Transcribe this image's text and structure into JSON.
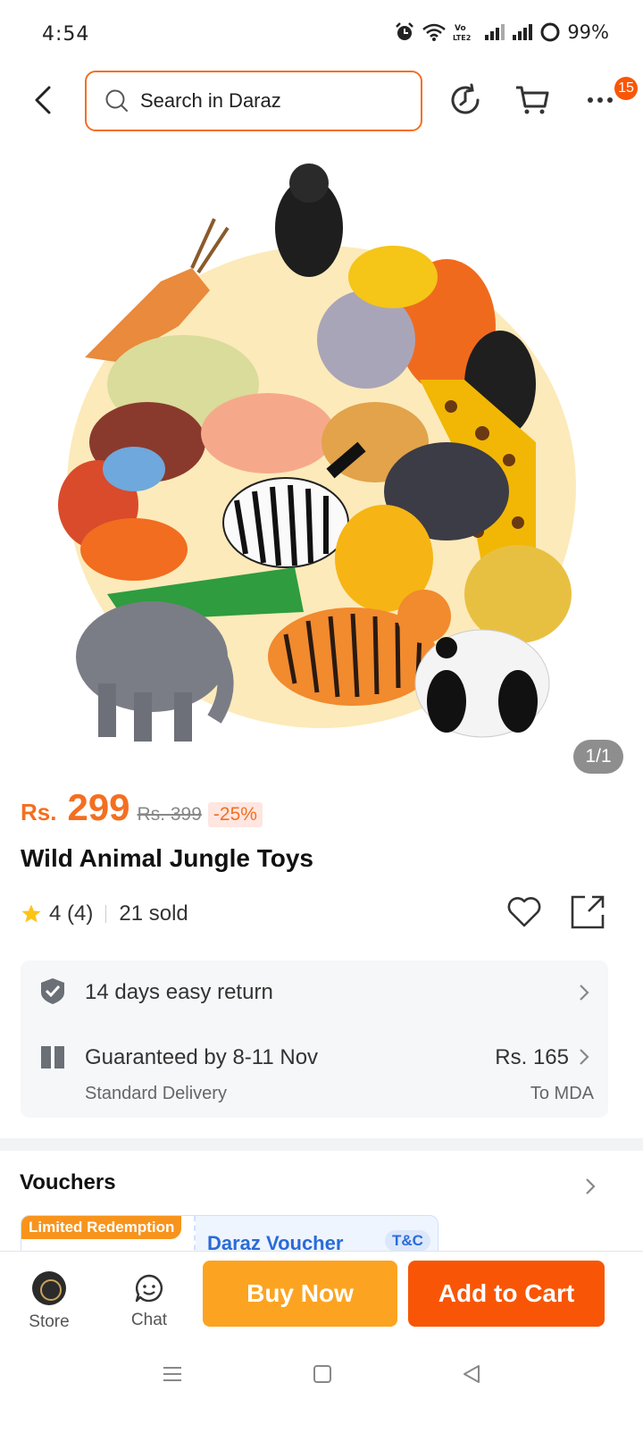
{
  "status_bar": {
    "time": "4:54",
    "battery_percent": "99%",
    "icons": [
      "alarm-icon",
      "wifi-icon",
      "volte-icon",
      "signal-icon",
      "signal-icon",
      "battery-icon"
    ]
  },
  "header": {
    "search_placeholder": "Search in Daraz",
    "icons": [
      "back-icon",
      "search-icon",
      "history-icon",
      "cart-icon",
      "more-icon"
    ],
    "notification_count": "15",
    "accent_color": "#f36f21"
  },
  "gallery": {
    "counter": "1/1",
    "image_description_icon": "product-photo"
  },
  "product": {
    "currency": "Rs.",
    "price": "299",
    "original_price": "Rs. 399",
    "discount": "-25%",
    "title": "Wild Animal Jungle Toys",
    "rating": "4 (4)",
    "sold": "21 sold",
    "price_color": "#f36f21"
  },
  "services": {
    "return_text": "14 days easy return",
    "delivery_text": "Guaranteed by 8-11 Nov",
    "delivery_type": "Standard Delivery",
    "delivery_fee": "Rs. 165",
    "delivery_destination": "To MDA"
  },
  "vouchers": {
    "title": "Vouchers",
    "tag": "Limited Redemption",
    "name": "Daraz Voucher",
    "terms": "T&C"
  },
  "action_bar": {
    "store_label": "Store",
    "chat_label": "Chat",
    "buy_now_label": "Buy Now",
    "add_to_cart_label": "Add to Cart",
    "buy_color": "#fca421",
    "cart_color": "#f85606"
  },
  "system_nav": {
    "icons": [
      "menu-icon",
      "home-icon",
      "back-triangle-icon"
    ]
  }
}
